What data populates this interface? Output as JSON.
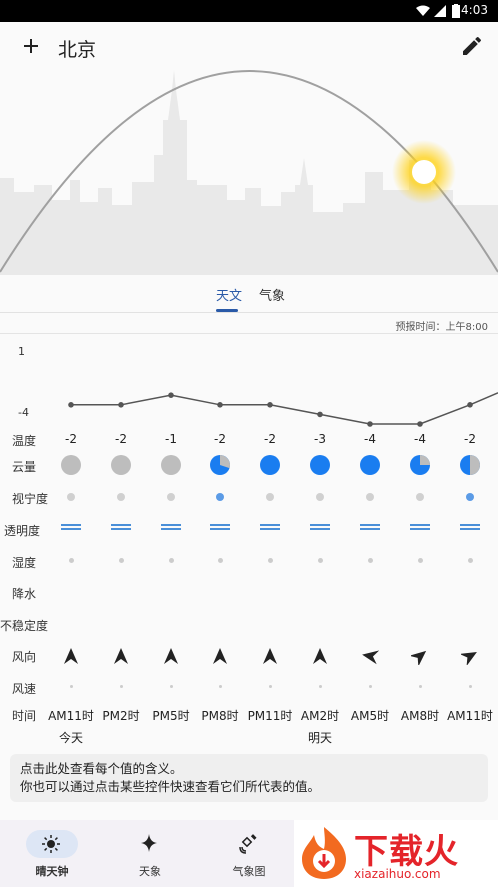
{
  "status": {
    "time": "4:03"
  },
  "header": {
    "city": "北京"
  },
  "tabs": [
    {
      "label": "天文",
      "active": true
    },
    {
      "label": "气象",
      "active": false
    }
  ],
  "forecast_time": "预报时间：上午8:00",
  "chart_axis": {
    "top": "1",
    "bottom": "-4"
  },
  "chart_data": {
    "type": "line",
    "x": [
      "AM11时",
      "PM2时",
      "PM5时",
      "PM8时",
      "PM11时",
      "AM2时",
      "AM5时",
      "AM8时",
      "AM11时"
    ],
    "values": [
      -2,
      -2,
      -1,
      -2,
      -2,
      -3,
      -4,
      -4,
      -2
    ],
    "ylim": [
      -4,
      1
    ]
  },
  "rows": {
    "temp": {
      "label": "温度",
      "values": [
        "-2",
        "-2",
        "-1",
        "-2",
        "-2",
        "-3",
        "-4",
        "-4",
        "-2"
      ]
    },
    "cloud": {
      "label": "云量",
      "values": [
        1.0,
        1.0,
        1.0,
        0.3,
        0.0,
        0.0,
        0.0,
        0.25,
        0.5
      ]
    },
    "seeing": {
      "label": "视宁度",
      "values": [
        "grey",
        "grey",
        "grey",
        "blue",
        "grey",
        "grey",
        "grey",
        "grey",
        "blue"
      ]
    },
    "transparency": {
      "label": "透明度"
    },
    "humidity": {
      "label": "湿度"
    },
    "precip": {
      "label": "降水"
    },
    "instability": {
      "label": "不稳定度"
    },
    "wind_dir": {
      "label": "风向",
      "angles": [
        0,
        0,
        0,
        0,
        0,
        0,
        -80,
        50,
        60
      ]
    },
    "wind_speed": {
      "label": "风速"
    },
    "time": {
      "label": "时间",
      "values": [
        "AM11时",
        "PM2时",
        "PM5时",
        "PM8时",
        "PM11时",
        "AM2时",
        "AM5时",
        "AM8时",
        "AM11时"
      ],
      "day_marks": [
        {
          "index": 0,
          "label": "今天"
        },
        {
          "index": 5,
          "label": "明天"
        }
      ]
    }
  },
  "info": {
    "line1": "点击此处查看每个值的含义。",
    "line2": "你也可以通过点击某些控件快速查看它们所代表的值。"
  },
  "nav": [
    {
      "label": "晴天钟",
      "icon": "sun-icon",
      "active": true
    },
    {
      "label": "天象",
      "icon": "sparkle-icon",
      "active": false
    },
    {
      "label": "气象图",
      "icon": "satellite-icon",
      "active": false
    }
  ],
  "watermark": {
    "brand": "下载火",
    "domain": "xiazaihuo.com"
  },
  "colors": {
    "accent": "#2a5aa8",
    "cloud_blue": "#1a7df0",
    "cloud_grey": "#bdbdbd"
  }
}
